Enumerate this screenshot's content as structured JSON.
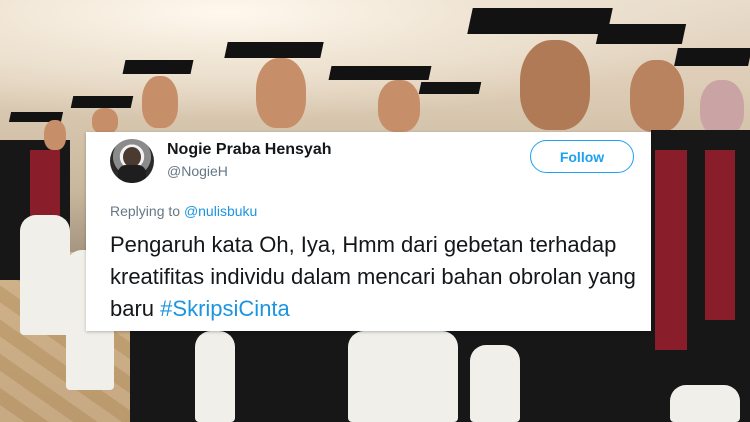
{
  "tweet": {
    "display_name": "Nogie Praba Hensyah",
    "handle": "@NogieH",
    "follow_label": "Follow",
    "replying_prefix": "Replying to",
    "replying_mention": "@nulisbuku",
    "body_text": "Pengaruh kata Oh, Iya, Hmm dari gebetan terhadap kreatifitas individu dalam mencari bahan obrolan yang baru",
    "hashtag": "#SkripsiCinta"
  },
  "colors": {
    "accent": "#1da1f2",
    "link": "#1b95e0",
    "text": "#14171a",
    "muted": "#657786"
  }
}
